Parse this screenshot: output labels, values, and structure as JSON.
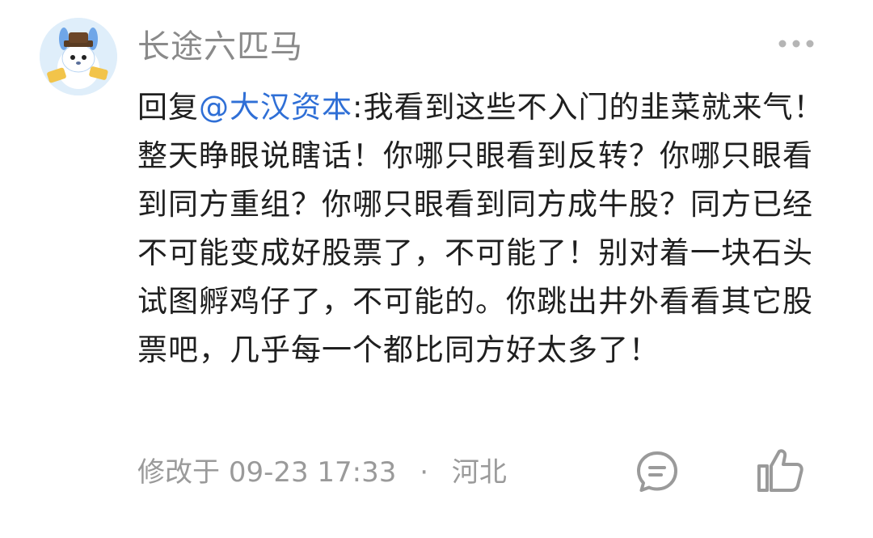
{
  "comment": {
    "author": "长途六匹马",
    "reply_prefix": "回复",
    "mention": "@大汉资本",
    "text": ":我看到这些不入门的韭菜就来气！整天睁眼说瞎话！你哪只眼看到反转？你哪只眼看到同方重组？你哪只眼看到同方成牛股？同方已经不可能变成好股票了，不可能了！别对着一块石头试图孵鸡仔了，不可能的。你跳出井外看看其它股票吧，几乎每一个都比同方好太多了！",
    "modified_label": "修改于",
    "timestamp": "09-23 17:33",
    "separator": "·",
    "location": "河北"
  },
  "icons": {
    "avatar": "avatar-image",
    "more": "more-dots-icon",
    "reply": "reply-bubble-icon",
    "like": "thumbs-up-icon"
  },
  "colors": {
    "mention": "#2f6fd6",
    "secondary_text": "#8a8a8a",
    "icon_gray": "#9a9a9a"
  }
}
